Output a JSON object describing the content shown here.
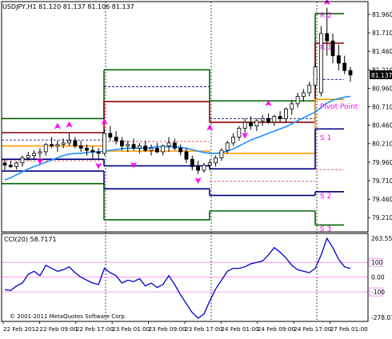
{
  "window": {
    "header": "USDJPY,H1  81.120 81.137 81.106 81.137",
    "copyright": "© 2001-2011 MetaQuotes Software Corp."
  },
  "price_axis": {
    "labels": [
      "81.960",
      "81.710",
      "81.460",
      "81.210",
      "80.960",
      "80.710",
      "80.460",
      "80.210",
      "79.960",
      "79.710",
      "79.460",
      "79.210"
    ],
    "current_price": "81.137"
  },
  "pivot_labels": {
    "r2": "R 2",
    "r1": "R 1",
    "pivot": "Pivot Point",
    "s1": "S 1",
    "s2": "S 2",
    "s3": "S 3"
  },
  "indicator": {
    "title": "CCI(20) 58.7171",
    "labels": [
      "263.5563",
      "100",
      "0.00",
      "-100",
      "-278.073"
    ]
  },
  "time_axis": {
    "labels": [
      "22 Feb 2012",
      "22 Feb 09:00",
      "22 Feb 17:00",
      "23 Feb 01:00",
      "23 Feb 09:00",
      "23 Feb 17:00",
      "24 Feb 01:00",
      "24 Feb 09:00",
      "24 Feb 17:00",
      "27 Feb 01:00"
    ]
  },
  "colors": {
    "background": "#ffffff",
    "candle": "#000000",
    "ma": "#1e90ff",
    "r_outer": "#006400",
    "r_mid": "#8b0000",
    "pivot": "#ff9900",
    "s_inner": "#000080",
    "s_outer": "#006400",
    "dashed_pivot": "#000080",
    "fractal": "#ff00ff",
    "cci": "#0000cc",
    "level_line": "#ee82ee"
  },
  "chart_data": {
    "type": "candlestick",
    "price_range": [
      79.05,
      82.1
    ],
    "cci_range": [
      -278.073,
      263.5563
    ],
    "cci_levels": [
      100,
      0,
      -100
    ],
    "candles": [
      [
        79.95,
        80.0,
        79.85,
        79.92
      ],
      [
        79.92,
        79.98,
        79.88,
        79.9
      ],
      [
        79.9,
        79.97,
        79.86,
        79.95
      ],
      [
        79.95,
        80.05,
        79.9,
        80.02
      ],
      [
        80.02,
        80.1,
        79.98,
        80.05
      ],
      [
        80.05,
        80.12,
        80.0,
        80.08
      ],
      [
        80.08,
        80.15,
        80.02,
        80.1
      ],
      [
        80.1,
        80.22,
        80.05,
        80.2
      ],
      [
        80.2,
        80.3,
        80.15,
        80.18
      ],
      [
        80.18,
        80.25,
        80.1,
        80.2
      ],
      [
        80.2,
        80.28,
        80.15,
        80.22
      ],
      [
        80.22,
        80.35,
        80.18,
        80.25
      ],
      [
        80.25,
        80.3,
        80.15,
        80.18
      ],
      [
        80.18,
        80.25,
        80.1,
        80.15
      ],
      [
        80.15,
        80.2,
        80.05,
        80.12
      ],
      [
        80.12,
        80.18,
        80.0,
        80.1
      ],
      [
        80.1,
        80.15,
        80.0,
        80.08
      ],
      [
        80.08,
        80.4,
        80.05,
        80.35
      ],
      [
        80.35,
        80.45,
        80.25,
        80.3
      ],
      [
        80.3,
        80.38,
        80.2,
        80.25
      ],
      [
        80.25,
        80.3,
        80.12,
        80.18
      ],
      [
        80.18,
        80.25,
        80.1,
        80.2
      ],
      [
        80.2,
        80.28,
        80.12,
        80.15
      ],
      [
        80.15,
        80.22,
        80.08,
        80.18
      ],
      [
        80.18,
        80.25,
        80.1,
        80.12
      ],
      [
        80.12,
        80.2,
        80.05,
        80.15
      ],
      [
        80.15,
        80.22,
        80.08,
        80.1
      ],
      [
        80.1,
        80.2,
        80.05,
        80.18
      ],
      [
        80.18,
        80.3,
        80.1,
        80.22
      ],
      [
        80.22,
        80.28,
        80.12,
        80.15
      ],
      [
        80.15,
        80.2,
        80.05,
        80.1
      ],
      [
        80.1,
        80.15,
        79.95,
        80.0
      ],
      [
        80.0,
        80.05,
        79.85,
        79.9
      ],
      [
        79.9,
        79.98,
        79.8,
        79.85
      ],
      [
        79.85,
        79.95,
        79.82,
        79.92
      ],
      [
        79.92,
        80.0,
        79.85,
        79.95
      ],
      [
        79.95,
        80.05,
        79.9,
        80.02
      ],
      [
        80.02,
        80.15,
        79.98,
        80.12
      ],
      [
        80.12,
        80.25,
        80.08,
        80.22
      ],
      [
        80.22,
        80.35,
        80.18,
        80.3
      ],
      [
        80.3,
        80.45,
        80.25,
        80.42
      ],
      [
        80.42,
        80.55,
        80.35,
        80.5
      ],
      [
        80.5,
        80.58,
        80.4,
        80.45
      ],
      [
        80.45,
        80.55,
        80.38,
        80.52
      ],
      [
        80.52,
        80.6,
        80.45,
        80.55
      ],
      [
        80.55,
        80.62,
        80.48,
        80.5
      ],
      [
        80.5,
        80.6,
        80.45,
        80.58
      ],
      [
        80.58,
        80.65,
        80.5,
        80.55
      ],
      [
        80.55,
        80.7,
        80.5,
        80.68
      ],
      [
        80.68,
        80.8,
        80.6,
        80.75
      ],
      [
        80.75,
        80.9,
        80.7,
        80.85
      ],
      [
        80.85,
        80.95,
        80.78,
        80.9
      ],
      [
        80.9,
        81.05,
        80.85,
        81.0
      ],
      [
        81.0,
        81.3,
        80.95,
        81.25
      ],
      [
        80.9,
        81.8,
        80.85,
        81.7
      ],
      [
        81.7,
        82.05,
        81.4,
        81.6
      ],
      [
        81.6,
        81.7,
        81.3,
        81.4
      ],
      [
        81.4,
        81.55,
        81.2,
        81.3
      ],
      [
        81.3,
        81.4,
        81.15,
        81.2
      ],
      [
        81.2,
        81.25,
        81.05,
        81.14
      ]
    ],
    "moving_average": [
      79.72,
      79.75,
      79.79,
      79.83,
      79.87,
      79.9,
      79.93,
      79.96,
      79.99,
      80.02,
      80.05,
      80.07,
      80.08,
      80.08,
      80.09,
      80.1,
      80.1,
      80.11,
      80.12,
      80.13,
      80.14,
      80.15,
      80.15,
      80.15,
      80.15,
      80.16,
      80.17,
      80.17,
      80.17,
      80.17,
      80.16,
      80.15,
      80.13,
      80.11,
      80.09,
      80.08,
      80.08,
      80.09,
      80.11,
      80.14,
      80.18,
      80.22,
      80.26,
      80.29,
      80.32,
      80.35,
      80.38,
      80.41,
      80.44,
      80.48,
      80.52,
      80.56,
      80.6,
      80.64,
      80.7,
      80.76,
      80.8,
      80.82,
      80.84,
      80.85
    ],
    "cci": [
      -85,
      -90,
      -60,
      -40,
      20,
      40,
      10,
      80,
      60,
      40,
      50,
      70,
      30,
      0,
      -20,
      -40,
      -50,
      60,
      30,
      10,
      -40,
      -20,
      -30,
      -10,
      -60,
      -40,
      -70,
      -50,
      10,
      -50,
      -120,
      -180,
      -240,
      -278,
      -250,
      -160,
      -80,
      -20,
      40,
      60,
      60,
      70,
      90,
      100,
      110,
      150,
      200,
      170,
      130,
      80,
      50,
      40,
      30,
      60,
      150,
      263,
      200,
      120,
      70,
      58.7
    ],
    "pivot_days": [
      {
        "r2": 80.55,
        "r1": 80.36,
        "pp": 80.18,
        "s1": 80.0,
        "s2": 79.84,
        "s3": 79.67,
        "pp_dashed": 80.26,
        "s_dashed": 79.98
      },
      {
        "r2": 81.21,
        "r1": 80.78,
        "pp": 80.11,
        "s1": 79.91,
        "s2": 79.6,
        "s3": 79.18,
        "pp_dashed": 80.98,
        "s_dashed": 80.24
      },
      {
        "r2": 80.79,
        "r1": 80.5,
        "pp": 80.08,
        "s1": 79.87,
        "s2": 79.51,
        "s3": 79.3,
        "pp_dashed": 80.55,
        "s_dashed": 79.7
      },
      {
        "r2": 81.97,
        "r1": 81.57,
        "pp": 80.81,
        "s1": 80.41,
        "s2": 79.56,
        "s3": 79.11,
        "pp_dashed": 81.08,
        "s_dashed": 79.86
      }
    ],
    "fractals_up": [
      [
        9,
        80.44
      ],
      [
        11,
        80.46
      ],
      [
        17,
        80.5
      ],
      [
        35,
        80.42
      ],
      [
        45,
        80.75
      ],
      [
        55,
        82.12
      ]
    ],
    "fractals_down": [
      [
        6,
        79.98
      ],
      [
        16,
        79.92
      ],
      [
        22,
        79.93
      ],
      [
        33,
        79.72
      ],
      [
        41,
        80.33
      ]
    ]
  }
}
